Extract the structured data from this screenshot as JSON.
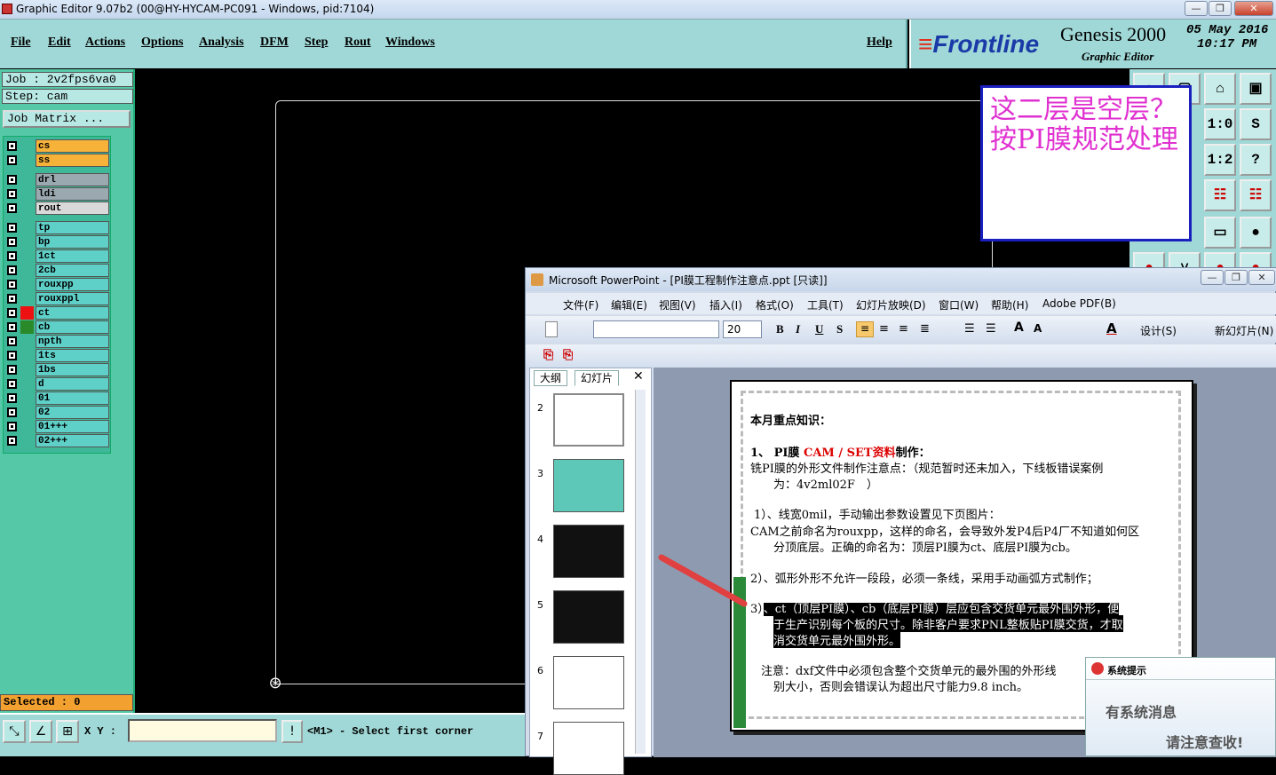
{
  "window": {
    "title": "Graphic Editor 9.07b2 (00@HY-HYCAM-PC091 - Windows, pid:7104)",
    "min": "—",
    "max": "❐",
    "close": "✕"
  },
  "menu": {
    "file": "File",
    "edit": "Edit",
    "actions": "Actions",
    "options": "Options",
    "analysis": "Analysis",
    "dfm": "DFM",
    "step": "Step",
    "rout": "Rout",
    "windows": "Windows",
    "help": "Help"
  },
  "brand": {
    "logo": "Frontline",
    "product": "Genesis 2000",
    "editor": "Graphic Editor",
    "date": "05 May 2016",
    "time": "10:17 PM"
  },
  "job": {
    "job_line": "Job : 2v2fps6va0",
    "step_line": "Step: cam",
    "matrix_button": "Job Matrix ..."
  },
  "layers": [
    {
      "name": "cs",
      "bg": "#f7b23a"
    },
    {
      "name": "ss",
      "bg": "#f7b23a"
    },
    {
      "name": "drl",
      "bg": "#9aa8b0"
    },
    {
      "name": "ldi",
      "bg": "#9aa8b0"
    },
    {
      "name": "rout",
      "bg": "#d9d9d9"
    },
    {
      "name": "tp",
      "bg": "#5ed0c8"
    },
    {
      "name": "bp",
      "bg": "#5ed0c8"
    },
    {
      "name": "1ct",
      "bg": "#5ed0c8"
    },
    {
      "name": "2cb",
      "bg": "#5ed0c8"
    },
    {
      "name": "rouxpp",
      "bg": "#5ed0c8"
    },
    {
      "name": "rouxppl",
      "bg": "#5ed0c8"
    },
    {
      "name": "ct",
      "bg": "#5ed0c8"
    },
    {
      "name": "cb",
      "bg": "#5ed0c8"
    },
    {
      "name": "npth",
      "bg": "#5ed0c8"
    },
    {
      "name": "1ts",
      "bg": "#5ed0c8"
    },
    {
      "name": "1bs",
      "bg": "#5ed0c8"
    },
    {
      "name": "d",
      "bg": "#5ed0c8"
    },
    {
      "name": "01",
      "bg": "#5ed0c8"
    },
    {
      "name": "02",
      "bg": "#5ed0c8"
    },
    {
      "name": "01+++",
      "bg": "#5ed0c8"
    },
    {
      "name": "02+++",
      "bg": "#5ed0c8"
    }
  ],
  "selected": "Selected : 0",
  "bottom": {
    "xy_label": "X Y :",
    "status": "<M1> - Select first corner",
    "warn": "!"
  },
  "note": "这二层是空层？按PI膜规范处理",
  "ppt": {
    "title": "Microsoft PowerPoint - [PI膜工程制作注意点.ppt [只读]]",
    "menu": [
      "文件(F)",
      "编辑(E)",
      "视图(V)",
      "插入(I)",
      "格式(O)",
      "工具(T)",
      "幻灯片放映(D)",
      "窗口(W)",
      "帮助(H)",
      "Adobe PDF(B)"
    ],
    "font_size": "20",
    "design": "设计(S)",
    "new_slide": "新幻灯片(N)",
    "tab_outline": "大纲",
    "tab_slides": "幻灯片",
    "thumb_numbers": [
      "2",
      "3",
      "4",
      "5",
      "6",
      "7"
    ],
    "slide": {
      "heading": "本月重点知识：",
      "item1_prefix": "1、 PI膜",
      "item1_red": "CAM / SET资料",
      "item1_suffix": "制作：",
      "line1": "铣PI膜的外形文件制作注意点：（规范暂时还未加入，下线板错误案例",
      "line2": "为：4v2ml02F　）",
      "line3": "1）、线宽0mil，手动输出参数设置见下页图片：",
      "line4": "CAM之前命名为rouxpp，这样的命名，会导致外发P4后P4厂不知道如何区",
      "line5": "分顶底层。正确的命名为：顶层PI膜为ct、底层PI膜为cb。",
      "line6": "2）、弧形外形不允许一段段，必须一条线，采用手动画弧方式制作；",
      "line7a": "3）",
      "line7b": "、ct（顶层PI膜）、cb（底层PI膜）层应包含交货单元最外围外形，便",
      "line8": "于生产识别每个板的尺寸。除非客户要求PNL整板贴PI膜交货，才取",
      "line9": "消交货单元最外围外形。",
      "line10": "注意：dxf文件中必须包含整个交货单元的最外围的外形线",
      "line11": "别大小，否则会错误认为超出尺寸能力9.8 inch。"
    },
    "popup": {
      "header": "系统提示",
      "line1": "有系统消息",
      "line2": "请注意查收!"
    }
  }
}
